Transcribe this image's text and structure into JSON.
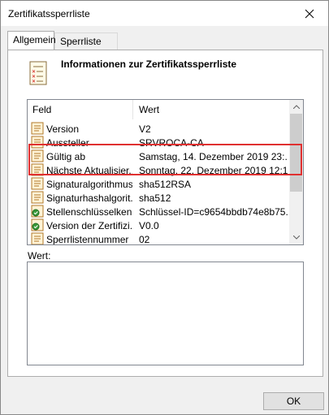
{
  "window": {
    "title": "Zertifikatssperrliste"
  },
  "tabs": [
    {
      "label": "Allgemein",
      "active": true
    },
    {
      "label": "Sperrliste",
      "active": false
    }
  ],
  "header": {
    "title": "Informationen zur Zertifikatssperrliste"
  },
  "listview": {
    "columns": [
      "Feld",
      "Wert"
    ],
    "rows": [
      {
        "field": "Version",
        "value": "V2",
        "icon": "certificate-field-icon"
      },
      {
        "field": "Aussteller",
        "value": "SRVROCA-CA",
        "icon": "certificate-field-icon"
      },
      {
        "field": "Gültig ab",
        "value": "Samstag, 14. Dezember 2019 23:...",
        "icon": "certificate-field-icon"
      },
      {
        "field": "Nächste Aktualisier...",
        "value": "Sonntag, 22. Dezember 2019 12:1...",
        "icon": "certificate-field-icon"
      },
      {
        "field": "Signaturalgorithmus",
        "value": "sha512RSA",
        "icon": "certificate-field-icon"
      },
      {
        "field": "Signaturhashalgorit...",
        "value": "sha512",
        "icon": "certificate-field-icon"
      },
      {
        "field": "Stellenschlüsselken...",
        "value": "Schlüssel-ID=c9654bbdb74e8b75...",
        "icon": "extension-icon"
      },
      {
        "field": "Version der Zertifizi...",
        "value": "V0.0",
        "icon": "extension-icon"
      },
      {
        "field": "Sperrlistennummer",
        "value": "02",
        "icon": "certificate-field-icon"
      }
    ]
  },
  "detail": {
    "label": "Wert:",
    "value": ""
  },
  "buttons": {
    "ok": "OK"
  },
  "colors": {
    "highlight": "#e03030",
    "accent": "#0078d7"
  }
}
